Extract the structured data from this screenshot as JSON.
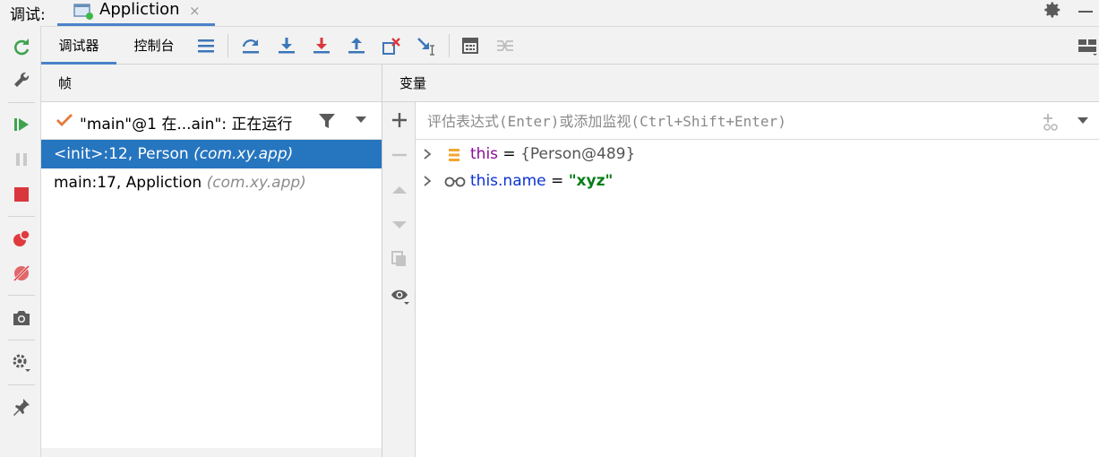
{
  "title_bar": {
    "label": "调试:",
    "run_tab": {
      "label": "Appliction",
      "close": "×"
    }
  },
  "toolbar": {
    "tabs": [
      {
        "label": "调试器",
        "active": true
      },
      {
        "label": "控制台",
        "active": false
      }
    ]
  },
  "frames": {
    "header": "帧",
    "thread": "\"main\"@1 在...ain\": 正在运行",
    "items": [
      {
        "method": "<init>:12, Person",
        "package": "(com.xy.app)",
        "selected": true
      },
      {
        "method": "main:17, Appliction",
        "package": "(com.xy.app)",
        "selected": false
      }
    ]
  },
  "variables": {
    "header": "变量",
    "eval_placeholder": "评估表达式(Enter)或添加监视(Ctrl+Shift+Enter)",
    "items": [
      {
        "name": "this",
        "eq": " = ",
        "value": "{Person@489}",
        "icon": "object-icon",
        "type": "object"
      },
      {
        "name": "this.name",
        "eq": " = ",
        "value": "\"xyz\"",
        "icon": "watch-glasses-icon",
        "type": "string"
      }
    ]
  },
  "colors": {
    "selection": "#2675bf",
    "accent_tab": "#4b82c9",
    "string_value": "#067d17",
    "field_name": "#0b33d1"
  }
}
